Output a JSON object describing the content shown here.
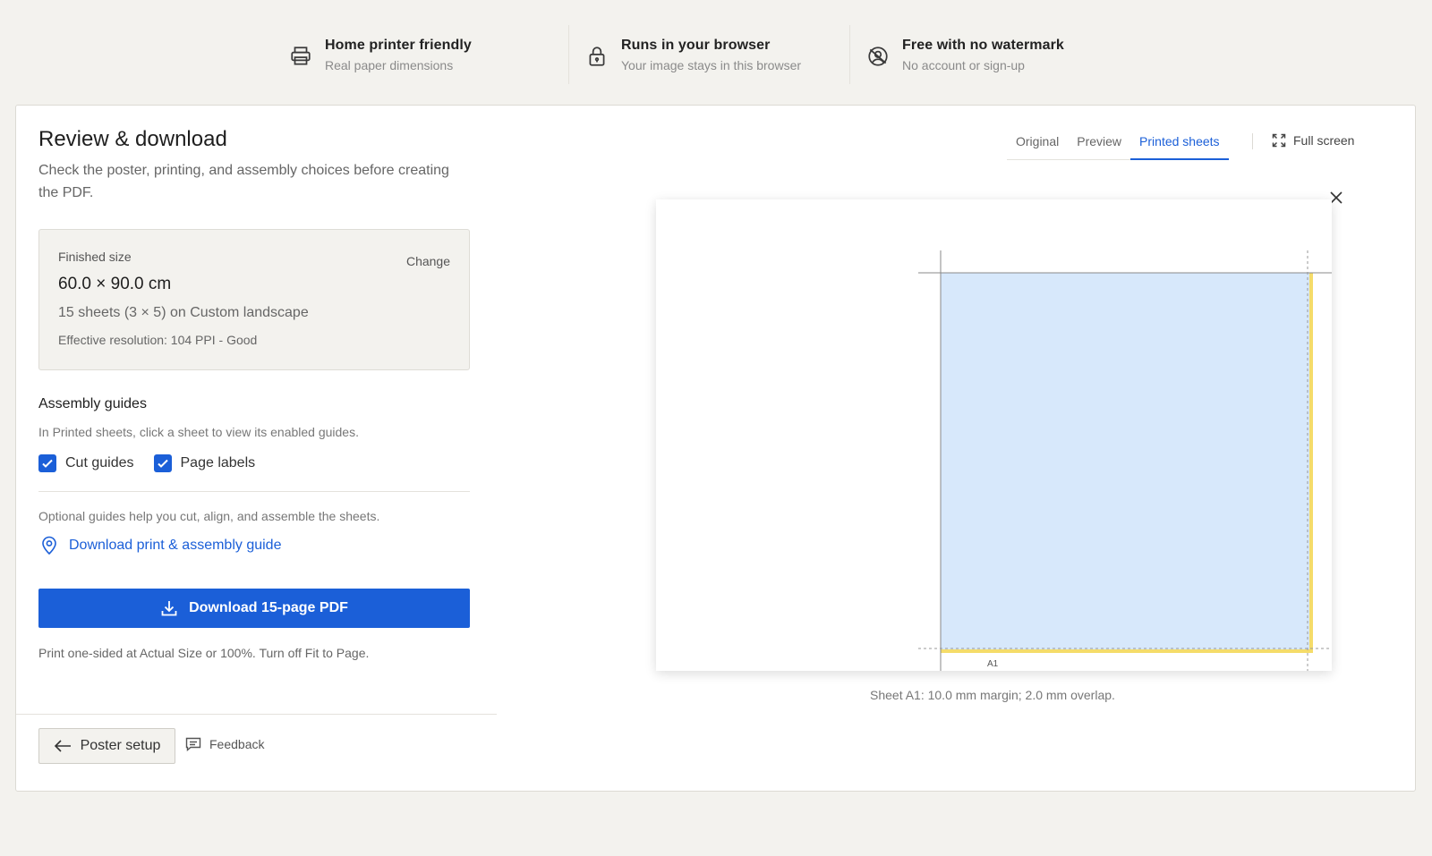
{
  "features": [
    {
      "icon": "printer-icon",
      "title": "Home printer friendly",
      "subtitle": "Real paper dimensions"
    },
    {
      "icon": "lock-icon",
      "title": "Runs in your browser",
      "subtitle": "Your image stays in this browser"
    },
    {
      "icon": "user-circle-icon",
      "title": "Free with no watermark",
      "subtitle": "No account or sign-up"
    }
  ],
  "review": {
    "title": "Review & download",
    "description": "Check the poster, printing, and assembly choices before creating the PDF."
  },
  "finished_size": {
    "label": "Finished size",
    "change_label": "Change",
    "value": "60.0 × 90.0 cm",
    "sheets": "15 sheets (3 × 5) on Custom landscape",
    "resolution": "Effective resolution: 104 PPI - Good"
  },
  "assembly": {
    "title": "Assembly guides",
    "description": "In Printed sheets, click a sheet to view its enabled guides.",
    "options": [
      {
        "label": "Cut guides",
        "checked": true
      },
      {
        "label": "Page labels",
        "checked": true
      }
    ],
    "optional_note": "Optional guides help you cut, align, and assemble the sheets.",
    "guide_link": "Download print & assembly guide"
  },
  "download": {
    "button_label": "Download 15-page PDF",
    "print_note": "Print one-sided at Actual Size or 100%. Turn off Fit to Page."
  },
  "footer": {
    "back_label": "Poster setup",
    "feedback_label": "Feedback"
  },
  "view": {
    "tabs": [
      "Original",
      "Preview",
      "Printed sheets"
    ],
    "active_tab": "Printed sheets",
    "fullscreen_label": "Full screen",
    "sheet_label": "A1",
    "caption": "Sheet A1: 10.0 mm margin; 2.0 mm overlap."
  },
  "colors": {
    "accent": "#1b5fd8",
    "image_fill": "#d7e8fb",
    "overlap_highlight": "#f5dc6a"
  }
}
